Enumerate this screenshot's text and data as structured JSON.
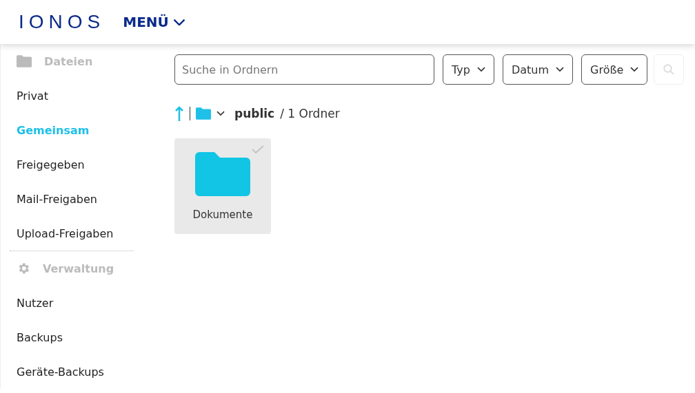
{
  "header": {
    "logo": "IONOS",
    "menu": "MENÜ"
  },
  "sidebar": {
    "sections": [
      {
        "title": "Dateien",
        "kind": "folder",
        "items": [
          {
            "label": "Privat",
            "selected": false
          },
          {
            "label": "Gemeinsam",
            "selected": true
          },
          {
            "label": "Freigegeben",
            "selected": false
          },
          {
            "label": "Mail-Freigaben",
            "selected": false
          },
          {
            "label": "Upload-Freigaben",
            "selected": false
          }
        ]
      },
      {
        "title": "Verwaltung",
        "kind": "gear",
        "items": [
          {
            "label": "Nutzer",
            "selected": false
          },
          {
            "label": "Backups",
            "selected": false
          },
          {
            "label": "Geräte-Backups",
            "selected": false
          }
        ]
      }
    ]
  },
  "toolbar": {
    "search": {
      "placeholder": "Suche in Ordnern"
    },
    "filters": [
      "Typ",
      "Datum",
      "Größe"
    ],
    "search_button": {
      "disabled": true
    }
  },
  "breadcrumb": {
    "folder": "public",
    "separator": "/",
    "count": "1 Ordner"
  },
  "items": [
    {
      "name": "Dokumente",
      "checked": false
    }
  ]
}
